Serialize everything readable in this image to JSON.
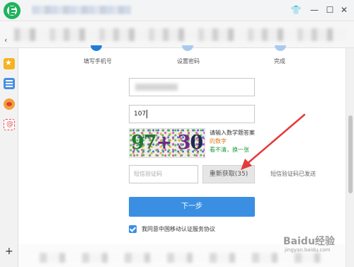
{
  "browser": {
    "tab_icon": "shirt-icon",
    "controls": {
      "minimize": "—",
      "maximize": "☐"
    }
  },
  "steps": [
    {
      "label": "填写手机号",
      "state": "done"
    },
    {
      "label": "设置密码",
      "state": "pending"
    },
    {
      "label": "完成",
      "state": "pending"
    }
  ],
  "form": {
    "captcha_value": "107",
    "captcha_image_text": {
      "part1": "97",
      "part2": "+ 3",
      "part3": "0="
    },
    "captcha_hint": {
      "line1": "请输入数学题答案",
      "line2": "的数字",
      "line3": "看不清，换一张"
    },
    "sms_placeholder": "短信验证码",
    "resend_label": "重新获取(35)",
    "sms_sent_label": "短信验证码已发送",
    "next_label": "下一步",
    "agree_text": "我同意中国移动认证服务协议",
    "agree_checked": true
  },
  "sidebar": {
    "icons": [
      "star-icon",
      "notes-icon",
      "weibo-icon",
      "mail-icon"
    ],
    "add_label": "+"
  },
  "colors": {
    "accent": "#3b8fe3",
    "brand_green": "#1fb35c"
  },
  "watermark": {
    "main": "Baidu经验",
    "sub": "jingyan.baidu.com"
  }
}
